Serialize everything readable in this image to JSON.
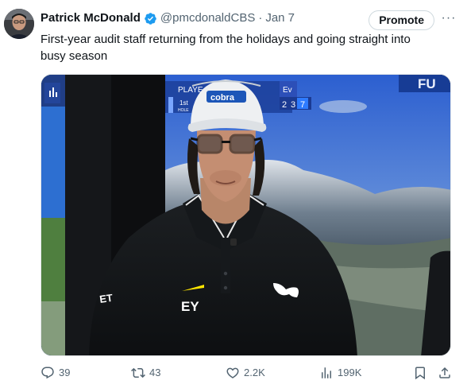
{
  "tweet": {
    "author_name": "Patrick McDonald",
    "author_handle": "@pmcdonaldCBS",
    "separator": "·",
    "date": "Jan 7",
    "promote_label": "Promote",
    "more_label": "···",
    "text": "First-year audit staff returning from the holidays and going straight into busy season"
  },
  "media": {
    "hat_brand": "cobra",
    "shirt_logo": "EY",
    "shirt_side_text": "ET",
    "screen_corner_text": "FU",
    "screen_player_label": "PLAYE",
    "screen_hole_label": "1st",
    "screen_hole_sub": "HOLE",
    "screen_ev_label": "Ev",
    "screen_numbers": [
      "2",
      "3",
      "7"
    ]
  },
  "actions": {
    "replies": "39",
    "reposts": "43",
    "likes": "2.2K",
    "views": "199K"
  },
  "colors": {
    "text_primary": "#0f1419",
    "text_secondary": "#536471",
    "verified": "#1d9bf0",
    "border": "#cfd9de"
  }
}
